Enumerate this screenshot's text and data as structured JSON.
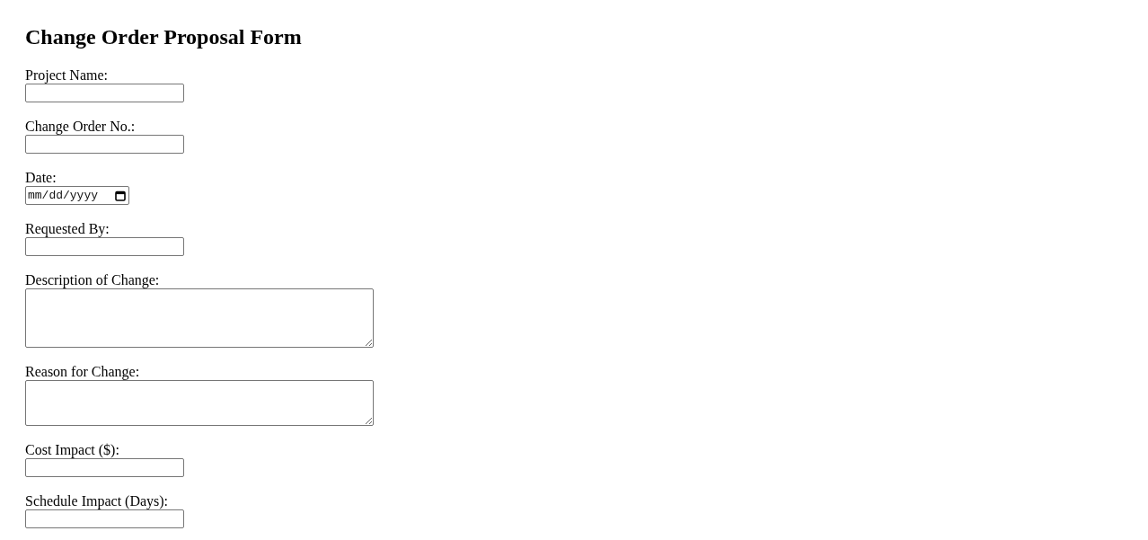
{
  "form": {
    "title": "Change Order Proposal Form",
    "fields": [
      {
        "label": "Project Name:",
        "kind": "text"
      },
      {
        "label": "Change Order No.:",
        "kind": "text"
      },
      {
        "label": "Date:",
        "kind": "date",
        "placeholder": "mm/dd/yyyy"
      },
      {
        "label": "Requested By:",
        "kind": "text"
      },
      {
        "label": "Description of Change:",
        "kind": "textarea"
      },
      {
        "label": "Reason for Change:",
        "kind": "textarea"
      },
      {
        "label": "Cost Impact ($):",
        "kind": "text"
      },
      {
        "label": "Schedule Impact (Days):",
        "kind": "text"
      }
    ]
  }
}
